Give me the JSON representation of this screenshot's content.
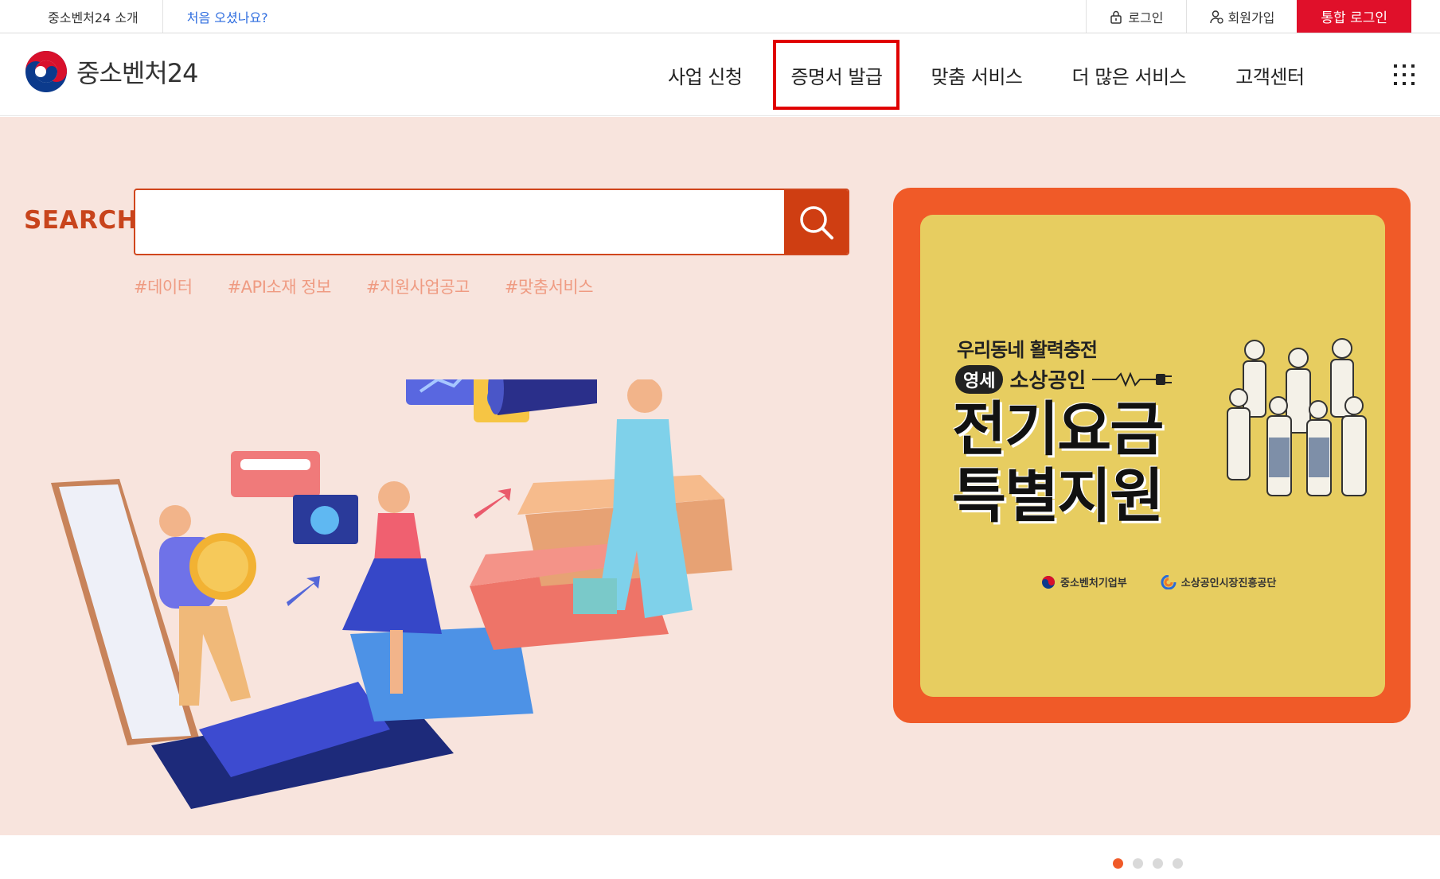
{
  "utility": {
    "about": "중소벤처24 소개",
    "first_visit": "처음 오셨나요?",
    "login": "로그인",
    "signup": "회원가입",
    "integrated_login": "통합 로그인"
  },
  "header": {
    "logo_text": "중소벤처24",
    "nav": [
      "사업 신청",
      "증명서 발급",
      "맞춤 서비스",
      "더 많은 서비스",
      "고객센터"
    ],
    "highlighted_nav": "증명서 발급"
  },
  "search": {
    "label": "SEARCH",
    "value": "",
    "placeholder": "",
    "tags": [
      "#데이터",
      "#API소재 정보",
      "#지원사업공고",
      "#맞춤서비스"
    ]
  },
  "banner": {
    "line1_prefix": "우리동네",
    "line1_bold": "활력충전",
    "line2_pill": "영세",
    "line2_text": "소상공인",
    "title_line1": "전기요금",
    "title_line2": "특별지원",
    "org1": "중소벤처기업부",
    "org2": "소상공인시장진흥공단",
    "slide_count": 4,
    "active_slide": 1
  },
  "colors": {
    "brand_red": "#e0102a",
    "search_orange": "#cf3e12",
    "hero_bg": "#f8e4dd",
    "banner_outer": "#f05a28",
    "banner_inner": "#e7cd60",
    "highlight_box": "#e00000"
  }
}
